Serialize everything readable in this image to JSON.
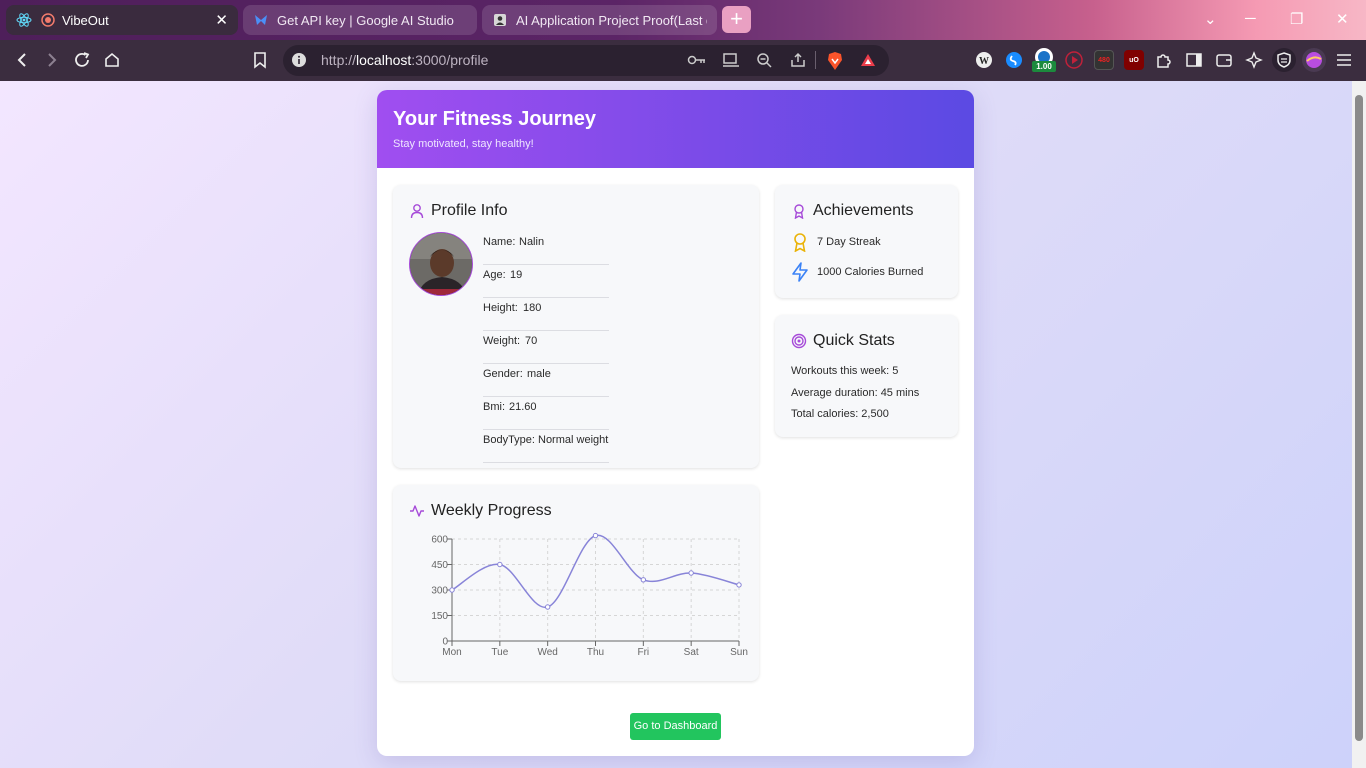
{
  "browser": {
    "tabs": [
      {
        "title": "VibeOut",
        "active": true
      },
      {
        "title": "Get API key | Google AI Studio",
        "active": false
      },
      {
        "title": "AI Application Project Proof(Last dat",
        "active": false
      }
    ],
    "url_prefix": "http://",
    "url_host": "localhost",
    "url_path": ":3000/profile",
    "extension_labels": {
      "ext_counter": "1.00",
      "ext_480": "480",
      "ext_ublock": "uO"
    }
  },
  "header": {
    "title": "Your Fitness Journey",
    "subtitle": "Stay motivated, stay healthy!"
  },
  "profile": {
    "title": "Profile Info",
    "fields": [
      {
        "label": "Name:",
        "value": "Nalin"
      },
      {
        "label": "Age:",
        "value": "19"
      },
      {
        "label": "Height:",
        "value": "180"
      },
      {
        "label": "Weight:",
        "value": "70"
      },
      {
        "label": "Gender:",
        "value": "male"
      },
      {
        "label": "Bmi:",
        "value": "21.60"
      },
      {
        "label": "BodyType:",
        "value": "Normal weight"
      }
    ]
  },
  "achievements": {
    "title": "Achievements",
    "items": [
      {
        "label": "7 Day Streak",
        "icon": "medal-icon"
      },
      {
        "label": "1000 Calories Burned",
        "icon": "lightning-icon"
      }
    ]
  },
  "quick_stats": {
    "title": "Quick Stats",
    "items": [
      "Workouts this week: 5",
      "Average duration: 45 mins",
      "Total calories: 2,500"
    ]
  },
  "weekly": {
    "title": "Weekly Progress"
  },
  "chart_data": {
    "type": "line",
    "categories": [
      "Mon",
      "Tue",
      "Wed",
      "Thu",
      "Fri",
      "Sat",
      "Sun"
    ],
    "series": [
      {
        "values": [
          300,
          450,
          200,
          620,
          360,
          400,
          330
        ]
      }
    ],
    "y_ticks": [
      0,
      150,
      300,
      450,
      600
    ],
    "ylim": [
      0,
      600
    ],
    "grid": true,
    "color": "#8884d8"
  },
  "dashboard_button": "Go to Dashboard",
  "colors": {
    "accent": "#8b5cf6",
    "button": "#22c55e"
  }
}
